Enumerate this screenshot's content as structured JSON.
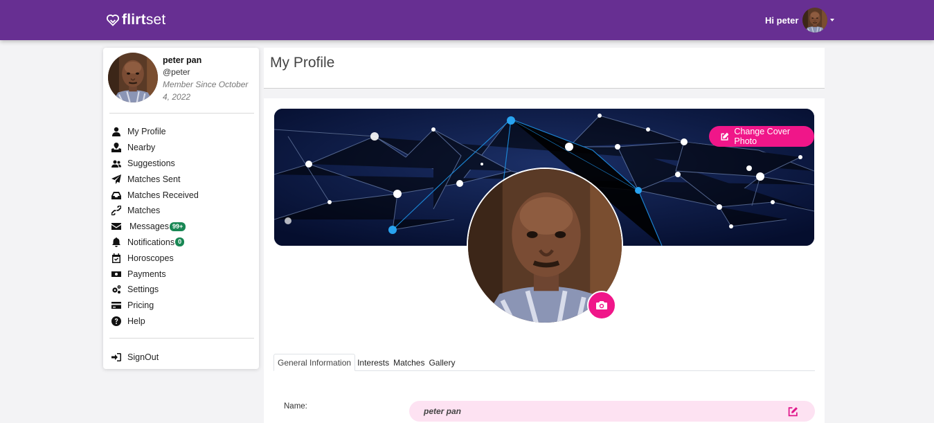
{
  "header": {
    "brand_name": "flirtset",
    "greeting": "Hi peter"
  },
  "sidebar": {
    "user": {
      "full_name": "peter pan",
      "handle": "@peter",
      "member_since": "Member Since October 4, 2022"
    },
    "items": [
      {
        "label": "My Profile",
        "icon": "user-icon"
      },
      {
        "label": "Nearby",
        "icon": "map-pin-icon"
      },
      {
        "label": "Suggestions",
        "icon": "users-icon"
      },
      {
        "label": "Matches Sent",
        "icon": "paper-plane-icon"
      },
      {
        "label": "Matches Received",
        "icon": "inbox-icon"
      },
      {
        "label": "Matches",
        "icon": "link-icon"
      },
      {
        "label": "Messages",
        "icon": "envelope-icon",
        "badge": "99+"
      },
      {
        "label": "Notifications",
        "icon": "bell-icon",
        "badge": "0"
      },
      {
        "label": "Horoscopes",
        "icon": "calendar-check-icon"
      },
      {
        "label": "Payments",
        "icon": "money-bill-icon"
      },
      {
        "label": "Settings",
        "icon": "cogs-icon"
      },
      {
        "label": "Pricing",
        "icon": "credit-card-icon"
      },
      {
        "label": "Help",
        "icon": "question-circle-icon"
      }
    ],
    "signout_label": "SignOut"
  },
  "main": {
    "title": "My Profile",
    "change_cover_label": "Change Cover Photo",
    "tabs": [
      {
        "label": "General Information",
        "active": true
      },
      {
        "label": "Interests",
        "active": false
      },
      {
        "label": "Matches",
        "active": false
      },
      {
        "label": "Gallery",
        "active": false
      }
    ],
    "fields": {
      "name_label": "Name:",
      "name_value": "peter pan"
    }
  },
  "colors": {
    "topbar": "#672f92",
    "accent_pink": "#f01689",
    "badge_green": "#198754",
    "field_bg": "#fde2f2"
  }
}
